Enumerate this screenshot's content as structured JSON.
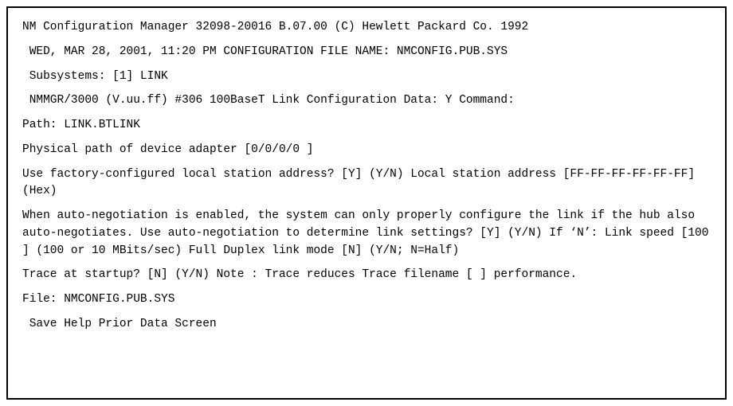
{
  "lines": {
    "header": "NM Configuration Manager 32098-20016 B.07.00 (C) Hewlett Packard Co. 1992",
    "datetime": " WED, MAR 28, 2001, 11:20 PM CONFIGURATION FILE NAME: NMCONFIG.PUB.SYS",
    "subsystems": " Subsystems: [1] LINK",
    "nmmgr": " NMMGR/3000 (V.uu.ff) #306 100BaseT Link Configuration Data: Y Command:",
    "path": "Path: LINK.BTLINK",
    "physical_path": "Physical path of device adapter [0/0/0/0 ]",
    "factory_config": "Use factory-configured local station address? [Y] (Y/N) Local station address [FF-FF-FF-FF-FF-FF] (Hex)",
    "auto_negotiation": "When auto-negotiation is enabled, the system can only properly configure the link if the hub also auto-negotiates. Use auto-negotiation to determine link settings? [Y] (Y/N) If ‘N’: Link speed [100 ] (100 or 10 MBits/sec) Full Duplex link mode [N] (Y/N; N=Half)",
    "trace": "Trace at startup? [N] (Y/N) Note : Trace reduces Trace filename [ ] performance.",
    "file": "File: NMCONFIG.PUB.SYS",
    "commands": " Save Help Prior Data Screen"
  },
  "fields": {
    "subsystem_option": "1",
    "subsystem_name": "LINK",
    "physical_path_value": "0/0/0/0",
    "factory_config_value": "Y",
    "local_station_address": "FF-FF-FF-FF-FF-FF",
    "auto_negotiation_value": "Y",
    "link_speed": "100",
    "full_duplex_mode": "N",
    "trace_at_startup": "N",
    "trace_filename": "",
    "config_file": "NMCONFIG.PUB.SYS"
  }
}
